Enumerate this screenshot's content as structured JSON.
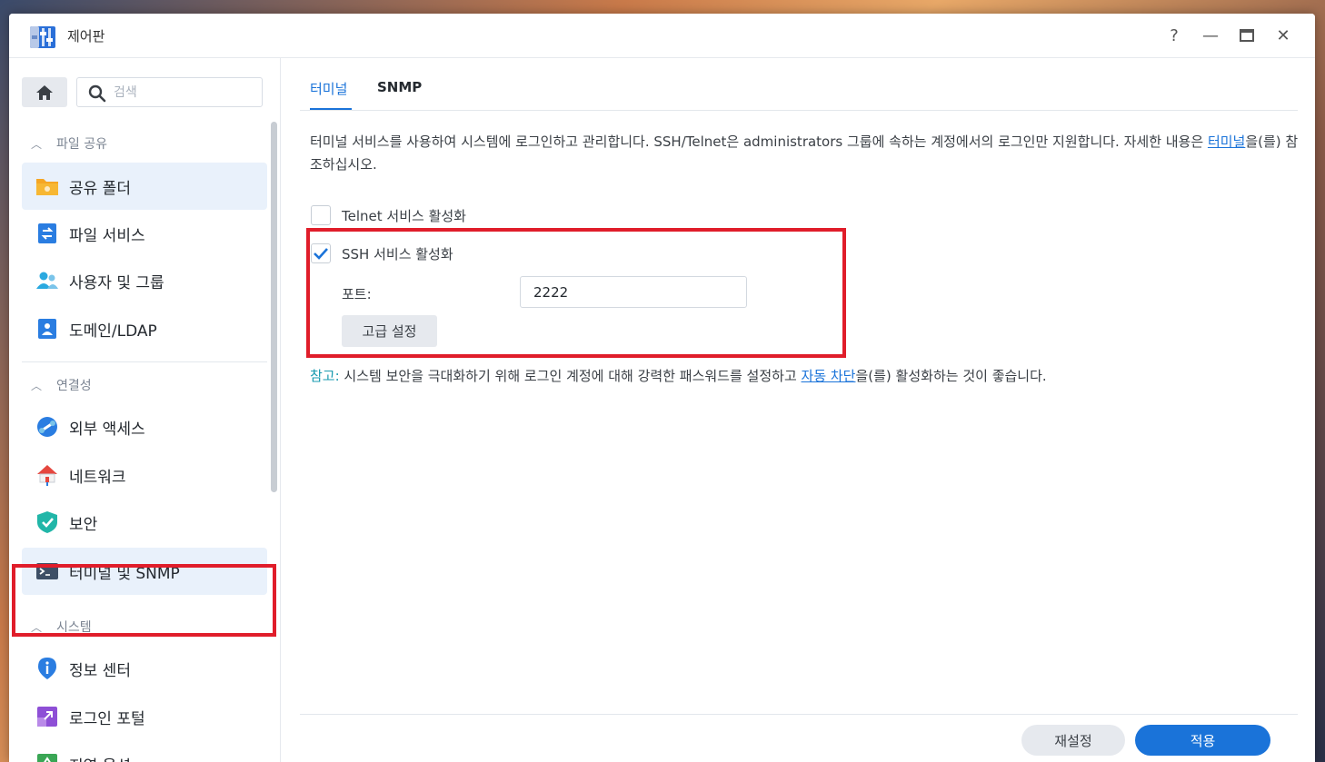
{
  "window": {
    "title": "제어판"
  },
  "window_controls": {
    "help": "?",
    "minimize": "—",
    "maximize": "▭",
    "close": "✕"
  },
  "sidebar": {
    "search_placeholder": "검색",
    "sections": [
      {
        "label": "파일 공유",
        "items": [
          {
            "label": "공유 폴더",
            "icon": "shared-folder-icon"
          },
          {
            "label": "파일 서비스",
            "icon": "file-services-icon"
          },
          {
            "label": "사용자 및 그룹",
            "icon": "users-groups-icon"
          },
          {
            "label": "도메인/LDAP",
            "icon": "domain-ldap-icon"
          }
        ]
      },
      {
        "label": "연결성",
        "items": [
          {
            "label": "외부 액세스",
            "icon": "external-access-icon"
          },
          {
            "label": "네트워크",
            "icon": "network-icon"
          },
          {
            "label": "보안",
            "icon": "security-shield-icon"
          },
          {
            "label": "터미널 및 SNMP",
            "icon": "terminal-icon"
          }
        ]
      },
      {
        "label": "시스템",
        "items": [
          {
            "label": "정보 센터",
            "icon": "info-center-icon"
          },
          {
            "label": "로그인 포털",
            "icon": "login-portal-icon"
          },
          {
            "label": "지역 옵션",
            "icon": "regional-options-icon"
          }
        ]
      }
    ]
  },
  "main": {
    "tabs": [
      {
        "label": "터미널"
      },
      {
        "label": "SNMP"
      }
    ],
    "description_part1": "터미널 서비스를 사용하여 시스템에 로그인하고 관리합니다. SSH/Telnet은 administrators 그룹에 속하는 계정에서의 로그인만 지원합니다. 자세한 내용은 ",
    "description_link": "터미널",
    "description_part2": "을(를) 참조하십시오.",
    "telnet_label": "Telnet 서비스 활성화",
    "telnet_checked": false,
    "ssh_label": "SSH 서비스 활성화",
    "ssh_checked": true,
    "port_label": "포트:",
    "port_value": "2222",
    "advanced_label": "고급 설정",
    "note_label": "참고:",
    "note_part1": " 시스템 보안을 극대화하기 위해 로그인 계정에 대해 강력한 패스워드를 설정하고 ",
    "note_link": "자동 차단",
    "note_part2": "을(를) 활성화하는 것이 좋습니다."
  },
  "footer": {
    "reset_label": "재설정",
    "apply_label": "적용"
  },
  "colors": {
    "accent": "#1a73d9",
    "highlight": "#e01d2a",
    "note": "#1a9bb0"
  }
}
